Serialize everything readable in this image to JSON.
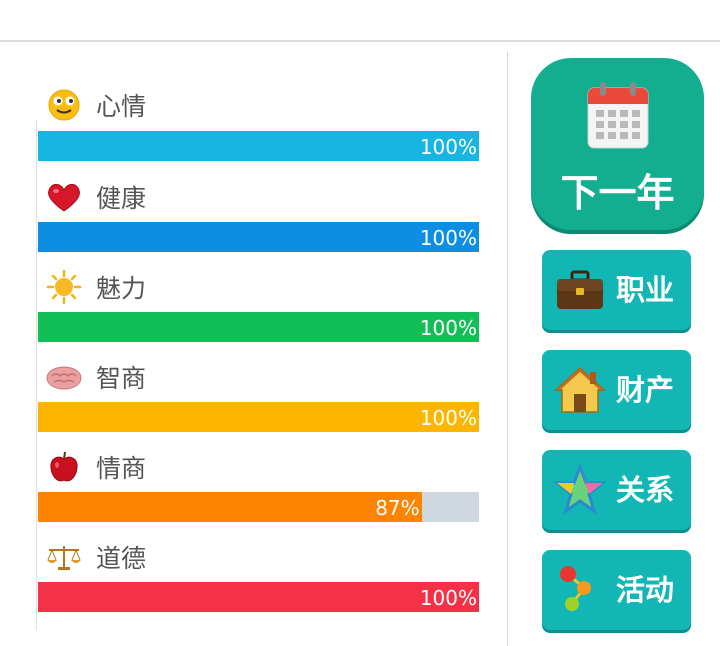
{
  "stats": [
    {
      "label": "心情",
      "value": 100,
      "text": "100%",
      "icon": "smiley-face-icon",
      "color": "#16b5e2"
    },
    {
      "label": "健康",
      "value": 100,
      "text": "100%",
      "icon": "heart-icon",
      "color": "#0c8fe3"
    },
    {
      "label": "魅力",
      "value": 100,
      "text": "100%",
      "icon": "sun-icon",
      "color": "#12bf57"
    },
    {
      "label": "智商",
      "value": 100,
      "text": "100%",
      "icon": "brain-icon",
      "color": "#fdb600"
    },
    {
      "label": "情商",
      "value": 87,
      "text": "87%",
      "icon": "apple-icon",
      "color": "#fd8400"
    },
    {
      "label": "道德",
      "value": 100,
      "text": "100%",
      "icon": "scales-icon",
      "color": "#f43146"
    }
  ],
  "bar_track_color": "#cfd7df",
  "next_year_button": {
    "label": "下一年",
    "icon": "calendar-icon",
    "color": "#12ae8f"
  },
  "side_buttons": [
    {
      "label": "职业",
      "icon": "briefcase-icon"
    },
    {
      "label": "财产",
      "icon": "house-icon"
    },
    {
      "label": "关系",
      "icon": "star-icon"
    },
    {
      "label": "活动",
      "icon": "molecule-icon"
    }
  ],
  "side_button_color": "#12b6b4"
}
